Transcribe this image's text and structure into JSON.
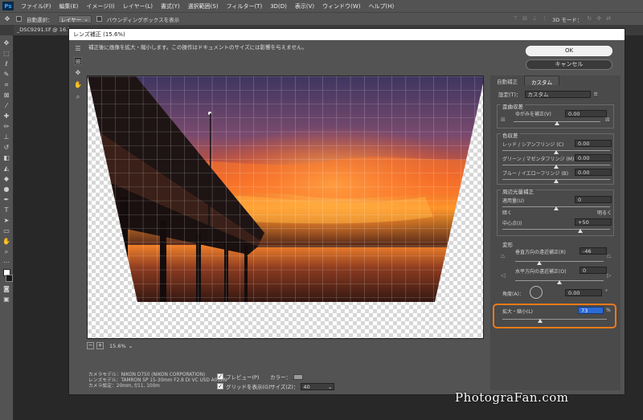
{
  "menubar": {
    "logo": "Ps",
    "items": [
      "ファイル(F)",
      "編集(E)",
      "イメージ(I)",
      "レイヤー(L)",
      "書式(Y)",
      "選択範囲(S)",
      "フィルター(T)",
      "3D(D)",
      "表示(V)",
      "ウィンドウ(W)",
      "ヘルプ(H)"
    ]
  },
  "options_bar": {
    "auto_select_label": "自動選択：",
    "layer_select": "レイヤー",
    "bounding_box_label": "バウンディングボックスを表示",
    "mode_3d": "3D モード："
  },
  "document_tab": "_DSC9291.tif @ 16.7",
  "dialog": {
    "title": "レンズ補正 (15.6%)",
    "hint": "補正後に画像を拡大・縮小します。この操作はドキュメントのサイズには影響を与えません。",
    "zoom": "15.6%",
    "camera_info": {
      "camera": "カメラモデル：NIKON D750 (NIKON CORPORATION)",
      "lens": "レンズモデル：TAMRON SP 15-30mm F2.8 Di VC USD A012N",
      "settings": "カメラ設定：20mm, f/11, 100m"
    },
    "preview_label": "プレビュー(P)",
    "grid_label": "グリッドを表示(G)",
    "color_label": "カラー：",
    "size_label": "サイズ(Z)：",
    "size_value": "40",
    "ok_label": "OK",
    "cancel_label": "キャンセル"
  },
  "panel": {
    "tabs": [
      "自動補正",
      "カスタム"
    ],
    "active_tab": 1,
    "setting_label": "設定(T)：",
    "setting_value": "カスタム",
    "distortion": {
      "title": "歪曲収差",
      "label": "ゆがみを補正(V)",
      "value": "0.00",
      "level": 0.5
    },
    "chromatic": {
      "title": "色収差",
      "red_cyan_label": "レッド / シアンフリンジ (C)",
      "red_cyan_value": "0.00",
      "green_magenta_label": "グリーン / マゼンタフリンジ (M)",
      "green_magenta_value": "0.00",
      "blue_yellow_label": "ブルー / イエローフリンジ (B)",
      "blue_yellow_value": "0.00"
    },
    "vignette": {
      "title": "周辺光量補正",
      "amount_label": "適用量(U)",
      "amount_value": "0",
      "dark_label": "暗く",
      "bright_label": "明るく",
      "midpoint_label": "中心点(I)",
      "midpoint_value": "+50"
    },
    "transform": {
      "title": "変形",
      "vertical_label": "垂直方向の遠近補正(R)",
      "vertical_value": "-46",
      "vertical_level": 0.27,
      "horizontal_label": "水平方向の遠近補正(O)",
      "horizontal_value": "0",
      "angle_label": "角度(A)：",
      "angle_value": "0.00",
      "angle_unit": "°",
      "scale_label": "拡大・縮小(L)",
      "scale_value": "73",
      "scale_unit": "%",
      "scale_level": 0.36
    }
  },
  "watermark": "PhotograFan.com",
  "colors": {
    "highlight": "#f07a1a",
    "selection": "#2c6bd6"
  }
}
